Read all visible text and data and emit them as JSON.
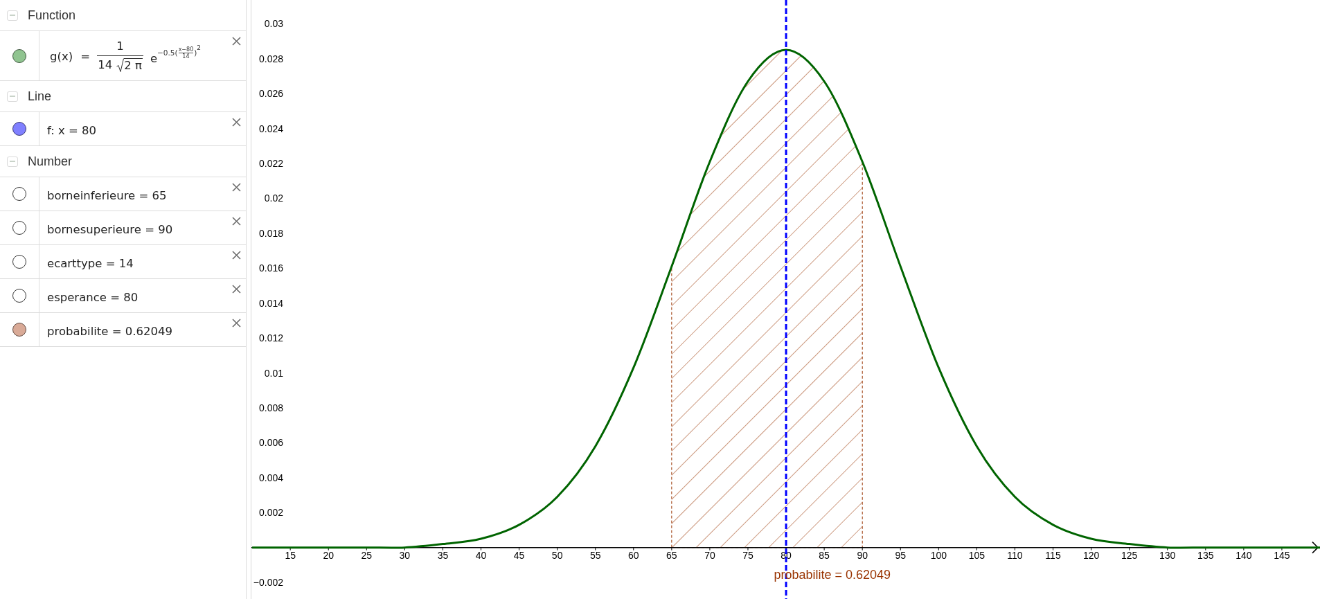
{
  "algebra_view": {
    "groups": [
      {
        "title": "Function",
        "expanded": true,
        "items": [
          {
            "kind": "formula",
            "shown": true,
            "color": "#90c490",
            "lhs": "g(x) =",
            "numerator": "1",
            "denominator": "14",
            "radicand": "2 π",
            "base": "e",
            "exponent_prefix": "−0.5(",
            "exponent_numerator": "x−80",
            "exponent_denominator": "14",
            "exponent_suffix": ")",
            "power": "2"
          }
        ]
      },
      {
        "title": "Line",
        "expanded": true,
        "items": [
          {
            "kind": "text",
            "shown": true,
            "color": "#8080ff",
            "text": "f: x = 80"
          }
        ]
      },
      {
        "title": "Number",
        "expanded": true,
        "items": [
          {
            "kind": "text",
            "shown": false,
            "text": "borneinferieure = 65"
          },
          {
            "kind": "text",
            "shown": false,
            "text": "bornesuperieure = 90"
          },
          {
            "kind": "text",
            "shown": false,
            "text": "ecarttype = 14"
          },
          {
            "kind": "text",
            "shown": false,
            "text": "esperance = 80"
          },
          {
            "kind": "text",
            "shown": true,
            "color": "#d9aa97",
            "text": "probabilite = 0.62049"
          }
        ]
      }
    ]
  },
  "graphics_view": {
    "chart_data": {
      "type": "line",
      "x": [
        10,
        15,
        20,
        25,
        30,
        35,
        40,
        45,
        50,
        55,
        60,
        65,
        70,
        75,
        80,
        85,
        90,
        95,
        100,
        105,
        110,
        115,
        120,
        125,
        130,
        135,
        140,
        145,
        150
      ],
      "series": [
        {
          "color": "#006400",
          "values": [
            0,
            0,
            0,
            0,
            0,
            0.0002,
            0.0005,
            0.0013,
            0.0029,
            0.0058,
            0.0103,
            0.0161,
            0.0221,
            0.0267,
            0.0285,
            0.0267,
            0.0221,
            0.0161,
            0.0103,
            0.0058,
            0.0029,
            0.0013,
            0.0005,
            0.0002,
            0,
            0,
            0,
            0,
            0
          ]
        }
      ],
      "xlim": [
        9.9,
        150
      ],
      "ylim": [
        -0.00295,
        0.03136
      ],
      "xticks": [
        15,
        20,
        25,
        30,
        35,
        40,
        45,
        50,
        55,
        60,
        65,
        70,
        75,
        80,
        85,
        90,
        95,
        100,
        105,
        110,
        115,
        120,
        125,
        130,
        135,
        140,
        145
      ],
      "yticks": [
        0.03,
        0.028,
        0.026,
        0.024,
        0.022,
        0.02,
        0.018,
        0.016,
        0.014,
        0.012,
        0.01,
        0.008,
        0.006,
        0.004,
        0.002,
        {
          "value": -0.002,
          "label": "−0.002"
        }
      ],
      "ref_lines": [
        {
          "axis": "x",
          "value": 80,
          "color": "#0000ff"
        }
      ],
      "bands": [
        {
          "axis": "x",
          "from": 65,
          "to": 90,
          "color": "#993300"
        }
      ],
      "annotations": [
        "probabilite = 0.62049"
      ]
    }
  }
}
